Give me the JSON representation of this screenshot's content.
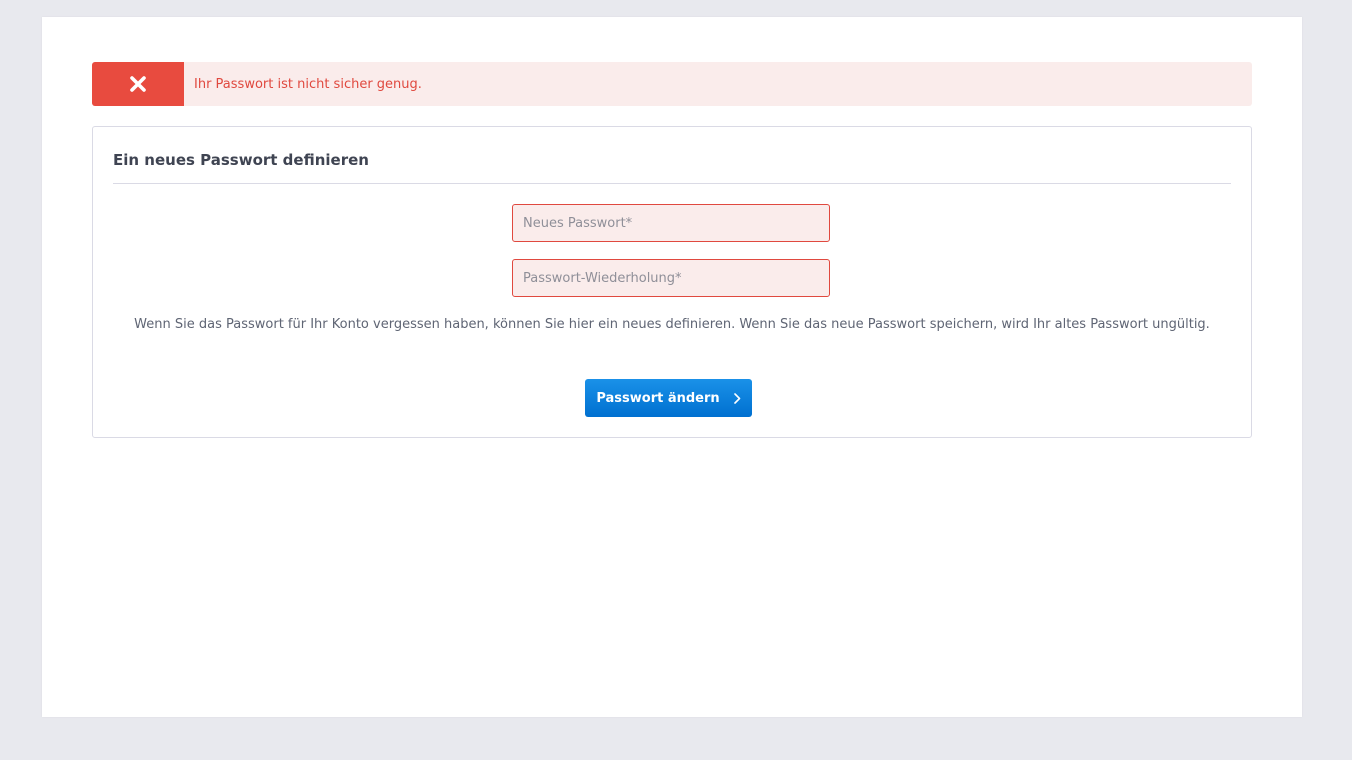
{
  "alert": {
    "message": "Ihr Passwort ist nicht sicher genug.",
    "icon": "close-icon",
    "color": "#e84b3f",
    "background": "#faeceb"
  },
  "panel": {
    "title": "Ein neues Passwort definieren",
    "fields": {
      "new_password_placeholder": "Neues Passwort*",
      "new_password_value": "",
      "repeat_password_placeholder": "Passwort-Wiederholung*",
      "repeat_password_value": ""
    },
    "info_text": "Wenn Sie das Passwort für Ihr Konto vergessen haben, können Sie hier ein neues definieren. Wenn Sie das neue Passwort speichern, wird Ihr altes Passwort ungültig.",
    "submit_label": "Passwort ändern",
    "submit_icon": "chevron-right-icon",
    "accent_color": "#0a80de"
  }
}
